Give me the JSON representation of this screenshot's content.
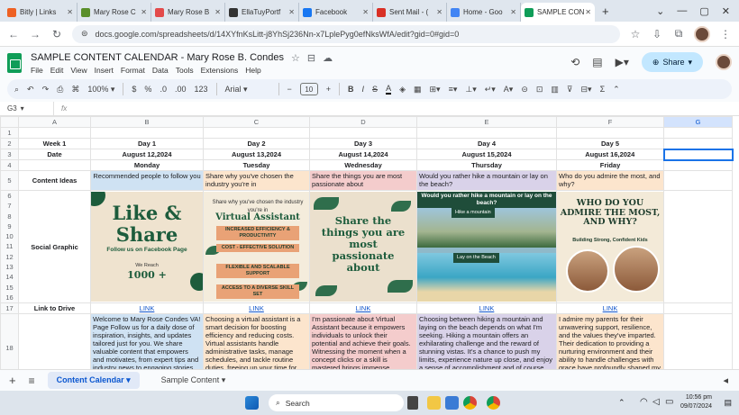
{
  "browser": {
    "tabs": [
      {
        "label": "Bitly | Links",
        "color": "#ee6123"
      },
      {
        "label": "Mary Rose C",
        "color": "#5a8f2a"
      },
      {
        "label": "Mary Rose B",
        "color": "#e34a4a"
      },
      {
        "label": "EllaTuyPortf",
        "color": "#333333"
      },
      {
        "label": "Facebook",
        "color": "#1877f2"
      },
      {
        "label": "Sent Mail - (",
        "color": "#d93025"
      },
      {
        "label": "Home - Goo",
        "color": "#4285f4"
      },
      {
        "label": "SAMPLE CON",
        "color": "#0f9d58"
      }
    ],
    "url": "docs.google.com/spreadsheets/d/14XYfnKsLitt-j8YhSj236Nn-x7LplePyg0efNksWfA/edit?gid=0#gid=0"
  },
  "doc": {
    "title": "SAMPLE CONTENT CALENDAR - Mary Rose B. Condes",
    "menus": [
      "File",
      "Edit",
      "View",
      "Insert",
      "Format",
      "Data",
      "Tools",
      "Extensions",
      "Help"
    ],
    "share_label": "Share"
  },
  "toolbar": {
    "zoom": "100%",
    "font": "Arial",
    "font_size": "10",
    "currency": "$",
    "percent": "%",
    "dec_dec": ".0",
    "dec_inc": ".00",
    "num_format": "123"
  },
  "formula": {
    "cell": "G3",
    "fx": "fx"
  },
  "grid": {
    "cols": [
      "A",
      "B",
      "C",
      "D",
      "E",
      "F",
      "G"
    ],
    "row_nums": [
      "1",
      "2",
      "3",
      "4",
      "5",
      "6",
      "7",
      "8",
      "9",
      "10",
      "11",
      "12",
      "13",
      "14",
      "15",
      "16",
      "17",
      "18"
    ],
    "row2": {
      "label": "Week 1",
      "days": [
        "Day 1",
        "Day 2",
        "Day 3",
        "Day 4",
        "Day 5"
      ]
    },
    "row3": {
      "label": "Date",
      "dates": [
        "August 12,2024",
        "August 13,2024",
        "August 14,2024",
        "August 15,2024",
        "August 16,2024"
      ]
    },
    "row4": {
      "weekdays": [
        "Monday",
        "Tuesday",
        "Wednesday",
        "Thursday",
        "Friday"
      ]
    },
    "row5": {
      "label": "Content Ideas",
      "ideas": [
        "Recommended people to follow you",
        "Share why you've chosen the industry you're in",
        "Share the things you are most passionate about",
        "Would you rather hike a mountain or lay on the beach?",
        "Who do you admire the most, and why?"
      ]
    },
    "row_graphic_label": "Social Graphic",
    "graphics": {
      "g1": {
        "line1": "Like &",
        "line2": "Share",
        "sub": "Follow us on Facebook Page",
        "small": "We Reach",
        "count": "1000 +"
      },
      "g2": {
        "header": "Share why you've chosen the industry you're in",
        "title": "Virtual Assistant",
        "pills": [
          "INCREASED EFFICIENCY & PRODUCTIVITY",
          "COST - EFFECTIVE SOLUTION",
          "FLEXIBLE AND SCALABLE SUPPORT",
          "ACCESS TO A DIVERSE SKILL SET"
        ]
      },
      "g3": {
        "text": "Share the things you are most passionate about"
      },
      "g4": {
        "header": "Would you rather hike a mountain or lay on the beach?",
        "tag1": "Hike a mountain",
        "tag2": "Lay on the Beach"
      },
      "g5": {
        "title": "WHO DO YOU ADMIRE THE MOST, AND WHY?",
        "sub": "Building Strong, Confident Kids"
      }
    },
    "row17": {
      "label": "Link to Drive",
      "links": [
        "LINK",
        "LINK",
        "LINK",
        "LINK",
        "LINK"
      ]
    },
    "row18": {
      "texts": [
        "Welcome to Mary Rose Condes VA! Page  Follow us for a daily dose of inspiration, insights, and updates tailored just for you. We share valuable content that empowers and motivates, from expert tips and industry news to engaging stories and community",
        "Choosing a virtual assistant is a smart decision for boosting efficiency and reducing costs. Virtual assistants handle administrative tasks, manage schedules, and tackle routine duties, freeing up your time for more strategic activities",
        "I'm passionate about Virtual Assistant because it empowers individuals to unlock their potential and achieve their goals. Witnessing the moment when a concept clicks or a skill is mastered brings immense satisfaction and drives my",
        "Choosing between hiking a mountain and laying on the beach depends on what I'm seeking. Hiking a mountain offers an exhilarating challenge and the reward of stunning vistas. It's a chance to push my limits, experience nature up close, and enjoy a sense of accomplishment and of course, laying on the beach provides",
        "I admire my parents for their unwavering support, resilience, and the values they've imparted. Their dedication to providing a nurturing environment and their ability to handle challenges with grace have profoundly shaped my character"
      ]
    }
  },
  "sheets": {
    "add": "+",
    "list": "≡",
    "tabs": [
      "Content Calendar",
      "Sample Content"
    ]
  },
  "taskbar": {
    "search": "Search",
    "time": "10:56 pm",
    "date": "09/07/2024",
    "lang": "ENG\nIN"
  }
}
